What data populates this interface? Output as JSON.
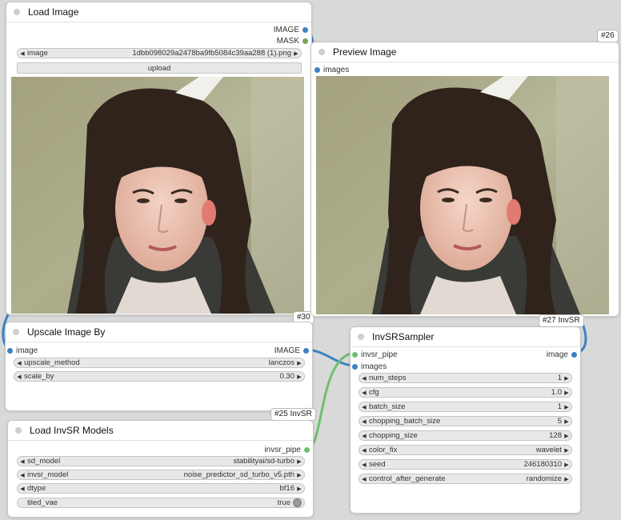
{
  "nodes": {
    "load_image": {
      "title": "Load Image",
      "badge": "#30",
      "outputs": [
        "IMAGE",
        "MASK"
      ],
      "image_widget": {
        "label": "image",
        "value": "1dbb098029a2478ba9fb5084c39aa288 (1).png"
      },
      "upload_label": "upload"
    },
    "preview_image": {
      "title": "Preview Image",
      "badge": "#26",
      "inputs": [
        "images"
      ]
    },
    "upscale_image_by": {
      "title": "Upscale Image By",
      "badge": "#25 InvSR",
      "input": "image",
      "output": "IMAGE",
      "widgets": [
        {
          "label": "upscale_method",
          "value": "lanczos"
        },
        {
          "label": "scale_by",
          "value": "0.30"
        }
      ]
    },
    "load_invsr_models": {
      "title": "Load InvSR Models",
      "output": "invsr_pipe",
      "widgets": [
        {
          "label": "sd_model",
          "value": "stabilityai/sd-turbo"
        },
        {
          "label": "invsr_model",
          "value": "noise_predictor_sd_turbo_v5.pth"
        },
        {
          "label": "dtype",
          "value": "bf16"
        }
      ],
      "toggle": {
        "label": "tiled_vae",
        "value": "true"
      }
    },
    "invsr_sampler": {
      "title": "InvSRSampler",
      "badge": "#27 InvSR",
      "inputs": [
        "invsr_pipe",
        "images"
      ],
      "output": "image",
      "widgets": [
        {
          "label": "num_steps",
          "value": "1"
        },
        {
          "label": "cfg",
          "value": "1.0"
        },
        {
          "label": "batch_size",
          "value": "1"
        },
        {
          "label": "chopping_batch_size",
          "value": "5"
        },
        {
          "label": "chopping_size",
          "value": "128"
        },
        {
          "label": "color_fix",
          "value": "wavelet"
        },
        {
          "label": "seed",
          "value": "246180310"
        },
        {
          "label": "control_after_generate",
          "value": "randomize"
        }
      ]
    }
  },
  "colors": {
    "canvas": "#d9d9d9",
    "image_wire": "#3b82c4",
    "pipe_wire": "#6cc06c"
  }
}
